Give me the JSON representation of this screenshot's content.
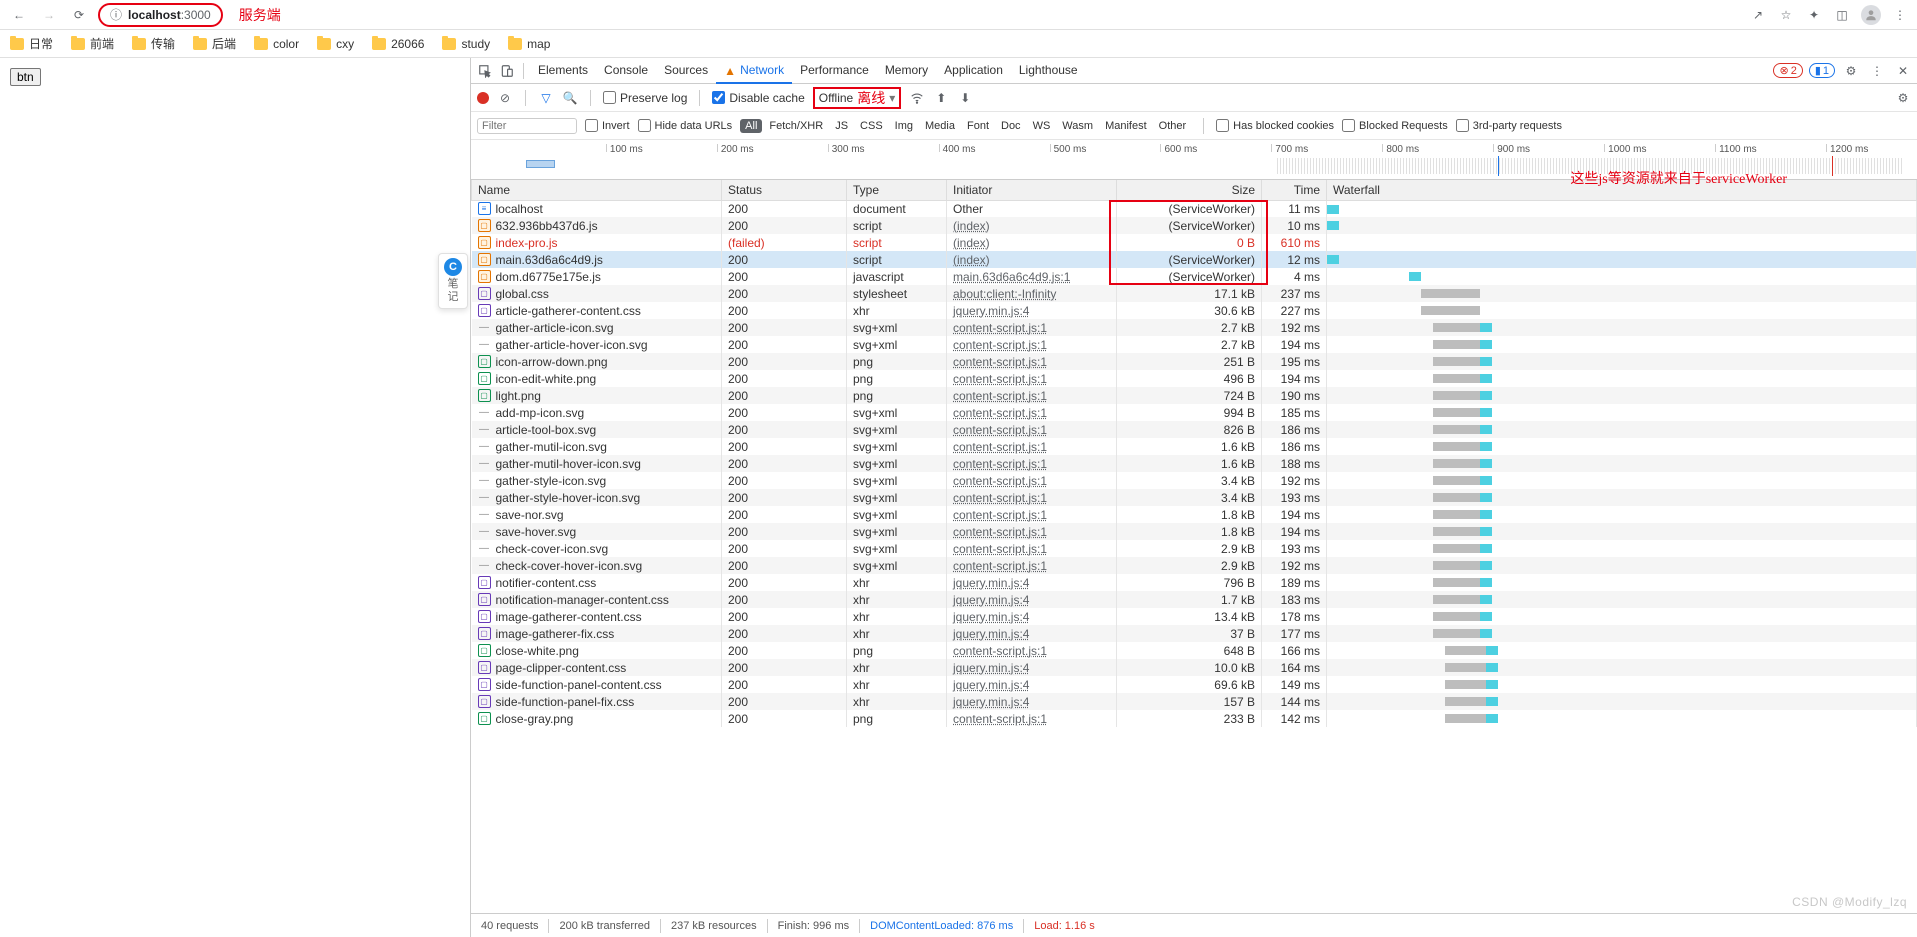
{
  "browser": {
    "url_host": "localhost",
    "url_port": ":3000",
    "annotation_server": "服务端",
    "bookmarks": [
      "日常",
      "前端",
      "传输",
      "后端",
      "color",
      "cxy",
      "26066",
      "study",
      "map"
    ]
  },
  "page": {
    "btn_label": "btn",
    "notes_label": "笔\n记"
  },
  "devtools": {
    "tabs": [
      "Elements",
      "Console",
      "Sources",
      "Network",
      "Performance",
      "Memory",
      "Application",
      "Lighthouse"
    ],
    "active_tab": "Network",
    "errors": "2",
    "infos": "1",
    "net_toolbar": {
      "preserve_log": "Preserve log",
      "disable_cache": "Disable cache",
      "throttle": "Offline",
      "annotation_offline": "离线"
    },
    "filter": {
      "placeholder": "Filter",
      "invert": "Invert",
      "hide_data_urls": "Hide data URLs",
      "chips": [
        "All",
        "Fetch/XHR",
        "JS",
        "CSS",
        "Img",
        "Media",
        "Font",
        "Doc",
        "WS",
        "Wasm",
        "Manifest",
        "Other"
      ],
      "active_chip": "All",
      "has_blocked": "Has blocked cookies",
      "blocked_req": "Blocked Requests",
      "third_party": "3rd-party requests"
    },
    "timeline_ticks": [
      "100 ms",
      "200 ms",
      "300 ms",
      "400 ms",
      "500 ms",
      "600 ms",
      "700 ms",
      "800 ms",
      "900 ms",
      "1000 ms",
      "1100 ms",
      "1200 ms"
    ],
    "annotation_sw": "这些js等资源就来自于serviceWorker",
    "columns": [
      "Name",
      "Status",
      "Type",
      "Initiator",
      "Size",
      "Time",
      "Waterfall"
    ],
    "rows": [
      {
        "ico": "doc",
        "name": "localhost",
        "status": "200",
        "type": "document",
        "initiator": "Other",
        "size": "(ServiceWorker)",
        "time": "11 ms",
        "wf": [
          0,
          2,
          "b"
        ]
      },
      {
        "ico": "js",
        "name": "632.936bb437d6.js",
        "status": "200",
        "type": "script",
        "initiator": "(index)",
        "ilink": true,
        "size": "(ServiceWorker)",
        "time": "10 ms",
        "wf": [
          0,
          2,
          "b"
        ]
      },
      {
        "ico": "js",
        "name": "index-pro.js",
        "status": "(failed)",
        "type": "script",
        "initiator": "(index)",
        "ilink": true,
        "size": "0 B",
        "time": "610 ms",
        "error": true
      },
      {
        "ico": "js",
        "name": "main.63d6a6c4d9.js",
        "status": "200",
        "type": "script",
        "initiator": "(index)",
        "ilink": true,
        "size": "(ServiceWorker)",
        "time": "12 ms",
        "selected": true,
        "wf": [
          0,
          2,
          "b"
        ]
      },
      {
        "ico": "js",
        "name": "dom.d6775e175e.js",
        "status": "200",
        "type": "javascript",
        "initiator": "main.63d6a6c4d9.js:1",
        "ilink": true,
        "size": "(ServiceWorker)",
        "time": "4 ms",
        "wf": [
          14,
          2,
          "b"
        ]
      },
      {
        "ico": "css",
        "name": "global.css",
        "status": "200",
        "type": "stylesheet",
        "initiator": "about:client:-Infinity",
        "ilink": true,
        "size": "17.1 kB",
        "time": "237 ms",
        "wf": [
          16,
          10
        ]
      },
      {
        "ico": "css",
        "name": "article-gatherer-content.css",
        "status": "200",
        "type": "xhr",
        "initiator": "jquery.min.js:4",
        "ilink": true,
        "size": "30.6 kB",
        "time": "227 ms",
        "wf": [
          16,
          10
        ]
      },
      {
        "ico": "svg",
        "name": "gather-article-icon.svg",
        "status": "200",
        "type": "svg+xml",
        "initiator": "content-script.js:1",
        "ilink": true,
        "size": "2.7 kB",
        "time": "192 ms",
        "wf": [
          18,
          8,
          "gb"
        ]
      },
      {
        "ico": "svg",
        "name": "gather-article-hover-icon.svg",
        "status": "200",
        "type": "svg+xml",
        "initiator": "content-script.js:1",
        "ilink": true,
        "size": "2.7 kB",
        "time": "194 ms",
        "wf": [
          18,
          8,
          "gb"
        ]
      },
      {
        "ico": "img",
        "name": "icon-arrow-down.png",
        "status": "200",
        "type": "png",
        "initiator": "content-script.js:1",
        "ilink": true,
        "size": "251 B",
        "time": "195 ms",
        "wf": [
          18,
          8,
          "gb"
        ]
      },
      {
        "ico": "img",
        "name": "icon-edit-white.png",
        "status": "200",
        "type": "png",
        "initiator": "content-script.js:1",
        "ilink": true,
        "size": "496 B",
        "time": "194 ms",
        "wf": [
          18,
          8,
          "gb"
        ]
      },
      {
        "ico": "img",
        "name": "light.png",
        "status": "200",
        "type": "png",
        "initiator": "content-script.js:1",
        "ilink": true,
        "size": "724 B",
        "time": "190 ms",
        "wf": [
          18,
          8,
          "gb"
        ]
      },
      {
        "ico": "svg",
        "name": "add-mp-icon.svg",
        "status": "200",
        "type": "svg+xml",
        "initiator": "content-script.js:1",
        "ilink": true,
        "size": "994 B",
        "time": "185 ms",
        "wf": [
          18,
          8,
          "gb"
        ]
      },
      {
        "ico": "svg",
        "name": "article-tool-box.svg",
        "status": "200",
        "type": "svg+xml",
        "initiator": "content-script.js:1",
        "ilink": true,
        "size": "826 B",
        "time": "186 ms",
        "wf": [
          18,
          8,
          "gb"
        ]
      },
      {
        "ico": "svg",
        "name": "gather-mutil-icon.svg",
        "status": "200",
        "type": "svg+xml",
        "initiator": "content-script.js:1",
        "ilink": true,
        "size": "1.6 kB",
        "time": "186 ms",
        "wf": [
          18,
          8,
          "gb"
        ]
      },
      {
        "ico": "svg",
        "name": "gather-mutil-hover-icon.svg",
        "status": "200",
        "type": "svg+xml",
        "initiator": "content-script.js:1",
        "ilink": true,
        "size": "1.6 kB",
        "time": "188 ms",
        "wf": [
          18,
          8,
          "gb"
        ]
      },
      {
        "ico": "svg",
        "name": "gather-style-icon.svg",
        "status": "200",
        "type": "svg+xml",
        "initiator": "content-script.js:1",
        "ilink": true,
        "size": "3.4 kB",
        "time": "192 ms",
        "wf": [
          18,
          8,
          "gb"
        ]
      },
      {
        "ico": "svg",
        "name": "gather-style-hover-icon.svg",
        "status": "200",
        "type": "svg+xml",
        "initiator": "content-script.js:1",
        "ilink": true,
        "size": "3.4 kB",
        "time": "193 ms",
        "wf": [
          18,
          8,
          "gb"
        ]
      },
      {
        "ico": "svg",
        "name": "save-nor.svg",
        "status": "200",
        "type": "svg+xml",
        "initiator": "content-script.js:1",
        "ilink": true,
        "size": "1.8 kB",
        "time": "194 ms",
        "wf": [
          18,
          8,
          "gb"
        ]
      },
      {
        "ico": "svg",
        "name": "save-hover.svg",
        "status": "200",
        "type": "svg+xml",
        "initiator": "content-script.js:1",
        "ilink": true,
        "size": "1.8 kB",
        "time": "194 ms",
        "wf": [
          18,
          8,
          "gb"
        ]
      },
      {
        "ico": "svg",
        "name": "check-cover-icon.svg",
        "status": "200",
        "type": "svg+xml",
        "initiator": "content-script.js:1",
        "ilink": true,
        "size": "2.9 kB",
        "time": "193 ms",
        "wf": [
          18,
          8,
          "gb"
        ]
      },
      {
        "ico": "svg",
        "name": "check-cover-hover-icon.svg",
        "status": "200",
        "type": "svg+xml",
        "initiator": "content-script.js:1",
        "ilink": true,
        "size": "2.9 kB",
        "time": "192 ms",
        "wf": [
          18,
          8,
          "gb"
        ]
      },
      {
        "ico": "css",
        "name": "notifier-content.css",
        "status": "200",
        "type": "xhr",
        "initiator": "jquery.min.js:4",
        "ilink": true,
        "size": "796 B",
        "time": "189 ms",
        "wf": [
          18,
          8,
          "gb"
        ]
      },
      {
        "ico": "css",
        "name": "notification-manager-content.css",
        "status": "200",
        "type": "xhr",
        "initiator": "jquery.min.js:4",
        "ilink": true,
        "size": "1.7 kB",
        "time": "183 ms",
        "wf": [
          18,
          8,
          "gb"
        ]
      },
      {
        "ico": "css",
        "name": "image-gatherer-content.css",
        "status": "200",
        "type": "xhr",
        "initiator": "jquery.min.js:4",
        "ilink": true,
        "size": "13.4 kB",
        "time": "178 ms",
        "wf": [
          18,
          8,
          "gb"
        ]
      },
      {
        "ico": "css",
        "name": "image-gatherer-fix.css",
        "status": "200",
        "type": "xhr",
        "initiator": "jquery.min.js:4",
        "ilink": true,
        "size": "37 B",
        "time": "177 ms",
        "wf": [
          18,
          8,
          "gb"
        ]
      },
      {
        "ico": "img",
        "name": "close-white.png",
        "status": "200",
        "type": "png",
        "initiator": "content-script.js:1",
        "ilink": true,
        "size": "648 B",
        "time": "166 ms",
        "wf": [
          20,
          7,
          "gb"
        ]
      },
      {
        "ico": "css",
        "name": "page-clipper-content.css",
        "status": "200",
        "type": "xhr",
        "initiator": "jquery.min.js:4",
        "ilink": true,
        "size": "10.0 kB",
        "time": "164 ms",
        "wf": [
          20,
          7,
          "gb"
        ]
      },
      {
        "ico": "css",
        "name": "side-function-panel-content.css",
        "status": "200",
        "type": "xhr",
        "initiator": "jquery.min.js:4",
        "ilink": true,
        "size": "69.6 kB",
        "time": "149 ms",
        "wf": [
          20,
          7,
          "gb"
        ]
      },
      {
        "ico": "css",
        "name": "side-function-panel-fix.css",
        "status": "200",
        "type": "xhr",
        "initiator": "jquery.min.js:4",
        "ilink": true,
        "size": "157 B",
        "time": "144 ms",
        "wf": [
          20,
          7,
          "gb"
        ]
      },
      {
        "ico": "img",
        "name": "close-gray.png",
        "status": "200",
        "type": "png",
        "initiator": "content-script.js:1",
        "ilink": true,
        "size": "233 B",
        "time": "142 ms",
        "wf": [
          20,
          7,
          "gb"
        ]
      }
    ],
    "status": {
      "requests": "40 requests",
      "transferred": "200 kB transferred",
      "resources": "237 kB resources",
      "finish": "Finish: 996 ms",
      "dom": "DOMContentLoaded: 876 ms",
      "load": "Load: 1.16 s"
    }
  },
  "watermark": "CSDN @Modify_lzq"
}
